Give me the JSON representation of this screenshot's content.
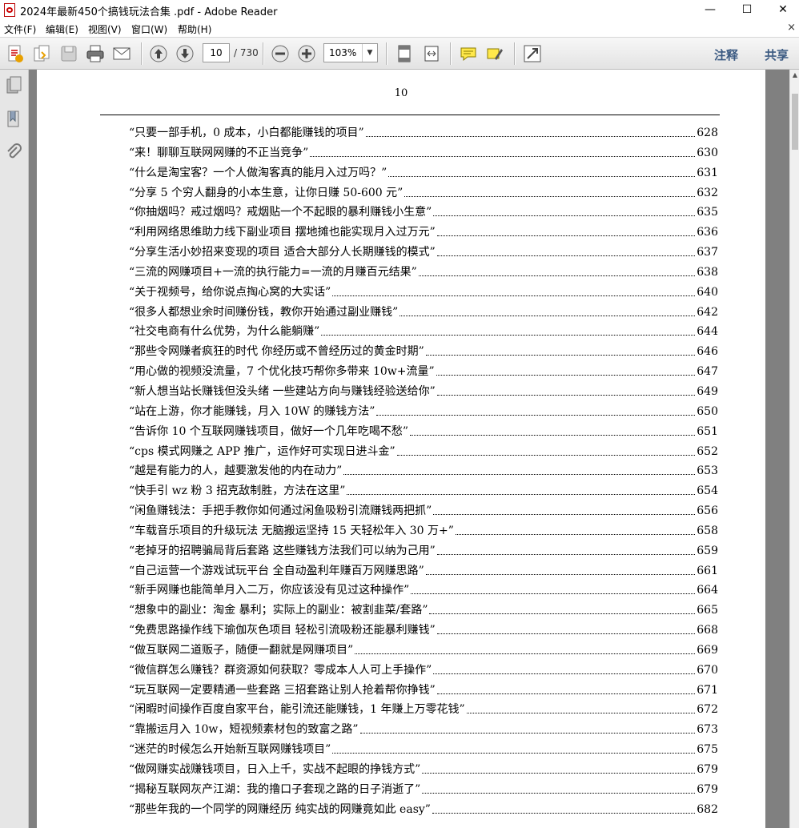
{
  "window": {
    "title": "2024年最新450个搞钱玩法合集 .pdf - Adobe Reader",
    "minimize": "—",
    "maximize": "☐",
    "close": "✕"
  },
  "menu": {
    "items": [
      "文件(F)",
      "编辑(E)",
      "视图(V)",
      "窗口(W)",
      "帮助(H)"
    ],
    "close_glyph": "×"
  },
  "toolbar": {
    "page_current": "10",
    "page_total": "/ 730",
    "zoom": "103%",
    "annotate": "注释",
    "share": "共享"
  },
  "document": {
    "page_number": "10",
    "toc": [
      {
        "title": "“只要一部手机，0 成本，小白都能赚钱的项目”",
        "page": "628"
      },
      {
        "title": "“来！聊聊互联网网赚的不正当竞争”",
        "page": "630"
      },
      {
        "title": "“什么是淘宝客？一个人做淘客真的能月入过万吗？”",
        "page": "631"
      },
      {
        "title": "“分享 5 个穷人翻身的小本生意，让你日赚 50-600 元”",
        "page": "632"
      },
      {
        "title": "“你抽烟吗？戒过烟吗？戒烟贴一个不起眼的暴利赚钱小生意”",
        "page": "635"
      },
      {
        "title": "“利用网络思维助力线下副业项目  摆地摊也能实现月入过万元”",
        "page": "636"
      },
      {
        "title": "“分享生活小妙招来变现的项目  适合大部分人长期赚钱的模式”",
        "page": "637"
      },
      {
        "title": "“三流的网赚项目+一流的执行能力=一流的月赚百元结果”",
        "page": "638"
      },
      {
        "title": "“关于视频号，给你说点掏心窝的大实话”",
        "page": "640"
      },
      {
        "title": "“很多人都想业余时间赚份钱，教你开始通过副业赚钱”",
        "page": "642"
      },
      {
        "title": "“社交电商有什么优势，为什么能躺赚”",
        "page": "644"
      },
      {
        "title": "“那些令网赚者疯狂的时代  你经历或不曾经历过的黄金时期”",
        "page": "646"
      },
      {
        "title": "“用心做的视频没流量，7 个优化技巧帮你多带来 10w+流量”",
        "page": "647"
      },
      {
        "title": "“新人想当站长赚钱但没头绪  一些建站方向与赚钱经验送给你”",
        "page": "649"
      },
      {
        "title": "“站在上游，你才能赚钱，月入 10W 的赚钱方法”",
        "page": "650"
      },
      {
        "title": "“告诉你 10 个互联网赚钱项目，做好一个几年吃喝不愁”",
        "page": "651"
      },
      {
        "title": "“cps 模式网赚之 APP 推广，运作好可实现日进斗金”",
        "page": "652"
      },
      {
        "title": "“越是有能力的人，越要激发他的内在动力”",
        "page": "653"
      },
      {
        "title": "“快手引 wz 粉 3 招克敌制胜，方法在这里”",
        "page": "654"
      },
      {
        "title": "“闲鱼赚钱法：手把手教你如何通过闲鱼吸粉引流赚钱两把抓”",
        "page": "656"
      },
      {
        "title": "“车载音乐项目的升级玩法  无脑搬运坚持 15 天轻松年入 30 万+”",
        "page": "658"
      },
      {
        "title": "“老掉牙的招聘骗局背后套路  这些赚钱方法我们可以纳为己用”",
        "page": "659"
      },
      {
        "title": "“自己运营一个游戏试玩平台  全自动盈利年赚百万网赚思路”",
        "page": "661"
      },
      {
        "title": "“新手网赚也能简单月入二万，你应该没有见过这种操作”",
        "page": "664"
      },
      {
        "title": "“想象中的副业：淘金  暴利；实际上的副业：被割韭菜/套路”",
        "page": "665"
      },
      {
        "title": "“免费思路操作线下瑜伽灰色项目  轻松引流吸粉还能暴利赚钱”",
        "page": "668"
      },
      {
        "title": "“做互联网二道贩子，随便一翻就是网赚项目”",
        "page": "669"
      },
      {
        "title": "“微信群怎么赚钱？群资源如何获取？零成本人人可上手操作”",
        "page": "670"
      },
      {
        "title": "“玩互联网一定要精通一些套路  三招套路让别人抢着帮你挣钱”",
        "page": "671"
      },
      {
        "title": "“闲暇时间操作百度自家平台，能引流还能赚钱，1 年赚上万零花钱”",
        "page": "672"
      },
      {
        "title": "“靠搬运月入 10w，短视频素材包的致富之路”",
        "page": "673"
      },
      {
        "title": "“迷茫的时候怎么开始新互联网赚钱项目”",
        "page": "675"
      },
      {
        "title": "“做网赚实战赚钱项目，日入上千，实战不起眼的挣钱方式”",
        "page": "679"
      },
      {
        "title": "“揭秘互联网灰产江湖：我的撸口子套现之路的日子消逝了”",
        "page": "679"
      },
      {
        "title": "“那些年我的一个同学的网赚经历  纯实战的网赚竟如此 easy”",
        "page": "682"
      }
    ]
  }
}
